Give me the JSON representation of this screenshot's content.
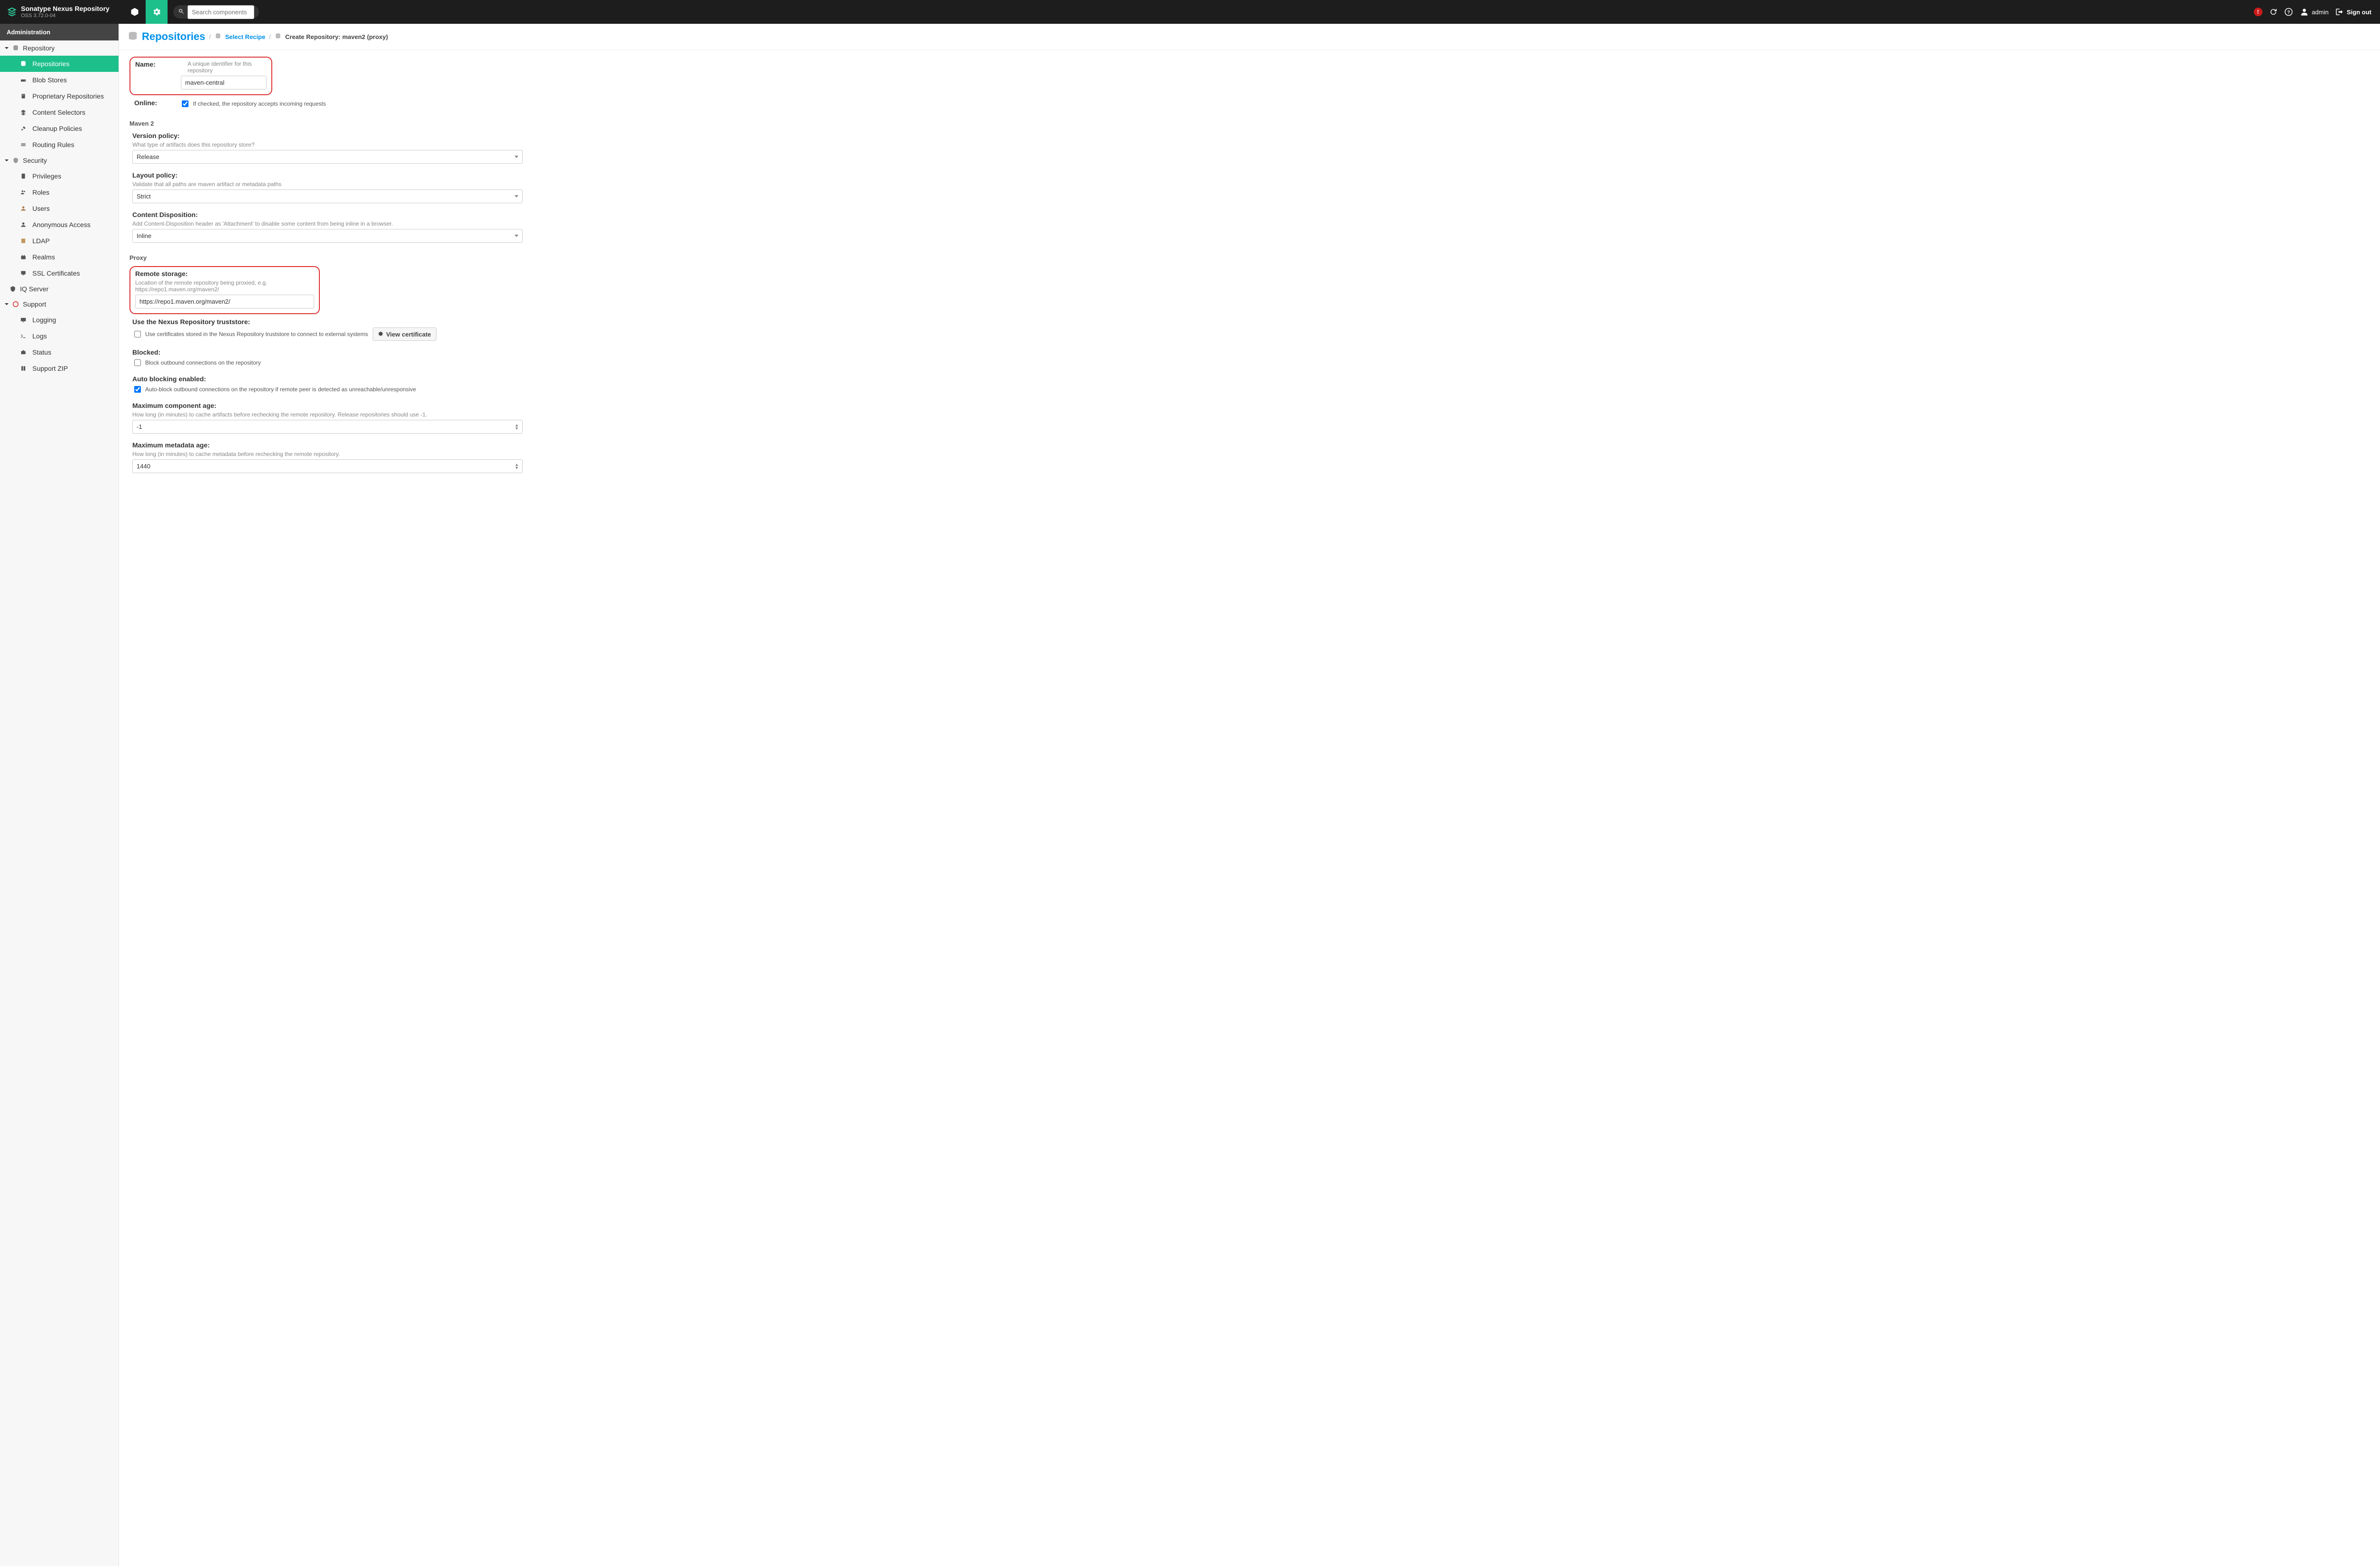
{
  "brand": {
    "title": "Sonatype Nexus Repository",
    "subtitle": "OSS 3.72.0-04"
  },
  "header": {
    "search_placeholder": "Search components",
    "user": "admin",
    "signout": "Sign out"
  },
  "sidebar": {
    "title": "Administration",
    "groups": {
      "repository": {
        "label": "Repository",
        "items": [
          {
            "id": "repositories",
            "label": "Repositories"
          },
          {
            "id": "blob-stores",
            "label": "Blob Stores"
          },
          {
            "id": "proprietary",
            "label": "Proprietary Repositories"
          },
          {
            "id": "content-selectors",
            "label": "Content Selectors"
          },
          {
            "id": "cleanup",
            "label": "Cleanup Policies"
          },
          {
            "id": "routing",
            "label": "Routing Rules"
          }
        ]
      },
      "security": {
        "label": "Security",
        "items": [
          {
            "id": "privileges",
            "label": "Privileges"
          },
          {
            "id": "roles",
            "label": "Roles"
          },
          {
            "id": "users",
            "label": "Users"
          },
          {
            "id": "anonymous",
            "label": "Anonymous Access"
          },
          {
            "id": "ldap",
            "label": "LDAP"
          },
          {
            "id": "realms",
            "label": "Realms"
          },
          {
            "id": "ssl",
            "label": "SSL Certificates"
          }
        ]
      },
      "iq": {
        "label": "IQ Server"
      },
      "support": {
        "label": "Support",
        "items": [
          {
            "id": "logging",
            "label": "Logging"
          },
          {
            "id": "logs",
            "label": "Logs"
          },
          {
            "id": "status",
            "label": "Status"
          },
          {
            "id": "support-zip",
            "label": "Support ZIP"
          }
        ]
      }
    }
  },
  "breadcrumb": {
    "title": "Repositories",
    "select_recipe": "Select Recipe",
    "current": "Create Repository: maven2 (proxy)"
  },
  "form": {
    "name": {
      "label": "Name:",
      "hint": "A unique identifier for this repository",
      "value": "maven-central"
    },
    "online": {
      "label": "Online:",
      "hint": "If checked, the repository accepts incoming requests",
      "checked": true
    },
    "maven2": {
      "section": "Maven 2",
      "version_policy": {
        "label": "Version policy:",
        "hint": "What type of artifacts does this repository store?",
        "value": "Release"
      },
      "layout_policy": {
        "label": "Layout policy:",
        "hint": "Validate that all paths are maven artifact or metadata paths",
        "value": "Strict"
      },
      "content_disposition": {
        "label": "Content Disposition:",
        "hint": "Add Content-Disposition header as 'Attachment' to disable some content from being inline in a browser.",
        "value": "Inline"
      }
    },
    "proxy": {
      "section": "Proxy",
      "remote_storage": {
        "label": "Remote storage:",
        "hint": "Location of the remote repository being proxied, e.g. https://repo1.maven.org/maven2/",
        "value": "https://repo1.maven.org/maven2/"
      },
      "truststore": {
        "label": "Use the Nexus Repository truststore:",
        "hint": "Use certificates stored in the Nexus Repository truststore to connect to external systems",
        "button": "View certificate"
      },
      "blocked": {
        "label": "Blocked:",
        "hint": "Block outbound connections on the repository"
      },
      "auto_blocking": {
        "label": "Auto blocking enabled:",
        "hint": "Auto-block outbound connections on the repository if remote peer is detected as unreachable/unresponsive",
        "checked": true
      },
      "max_component_age": {
        "label": "Maximum component age:",
        "hint": "How long (in minutes) to cache artifacts before rechecking the remote repository. Release repositories should use -1.",
        "value": "-1"
      },
      "max_metadata_age": {
        "label": "Maximum metadata age:",
        "hint": "How long (in minutes) to cache metadata before rechecking the remote repository.",
        "value": "1440"
      }
    }
  }
}
